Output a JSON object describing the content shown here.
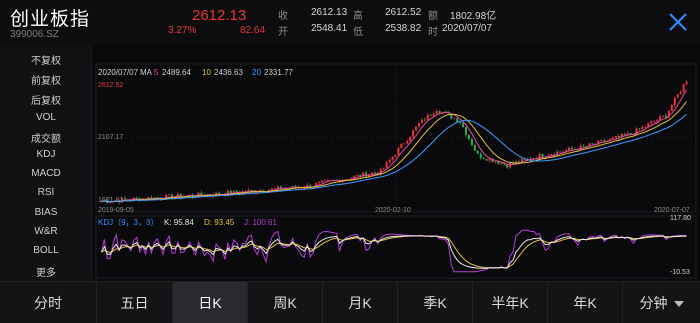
{
  "header": {
    "title": "创业板指",
    "code": "399006.SZ",
    "price": "2612.13",
    "change_pct": "3.27%",
    "change": "82.64",
    "quote": [
      {
        "label": "收",
        "value": "2612.13"
      },
      {
        "label": "高",
        "value": "2612.52"
      },
      {
        "label": "额",
        "value": "1802.98亿"
      },
      {
        "label": "开",
        "value": "2548.41"
      },
      {
        "label": "低",
        "value": "2538.82"
      },
      {
        "label": "时",
        "value": "2020/07/07"
      }
    ],
    "close_icon": "close-x-icon"
  },
  "sidebar": {
    "items": [
      {
        "label": "不复权",
        "active": true
      },
      {
        "label": "前复权",
        "active": false
      },
      {
        "label": "后复权",
        "active": false
      },
      {
        "label": "VOL",
        "active": false
      },
      {
        "label": "成交额",
        "active": false
      },
      {
        "label": "KDJ",
        "active": true
      },
      {
        "label": "MACD",
        "active": false
      },
      {
        "label": "RSI",
        "active": false
      },
      {
        "label": "BIAS",
        "active": false
      },
      {
        "label": "W&R",
        "active": false
      },
      {
        "label": "BOLL",
        "active": false
      },
      {
        "label": "更多",
        "active": false
      }
    ]
  },
  "main_chart": {
    "date": "2020/07/07",
    "ma_label": "MA",
    "ma": [
      {
        "name": "5",
        "value": "2489.64",
        "color": "#e84aa3"
      },
      {
        "name": "10",
        "value": "2436.63",
        "color": "#e0c23a"
      },
      {
        "name": "20",
        "value": "2331.77",
        "color": "#3f9bff"
      }
    ],
    "high_label": "2612.52",
    "mid_label": "2107.17",
    "low_label": "1601.81",
    "x_labels": [
      "2019-09-05",
      "2020-02-10",
      "2020-07-07"
    ]
  },
  "kdj_chart": {
    "label": "KDJ（9，3，3）",
    "k": "K: 95.84",
    "d": "D: 93.45",
    "j": "J: 100.61",
    "max_label": "117.80",
    "min_label": "-10.53",
    "colors": {
      "k": "#e8e8e8",
      "d": "#e0c23a",
      "j": "#b43fd6"
    }
  },
  "colors": {
    "up": "#e8353b",
    "down": "#27b04a",
    "accent": "#2f8fff"
  },
  "tabs": [
    {
      "label": "分时",
      "active": false
    },
    {
      "label": "五日",
      "active": false
    },
    {
      "label": "日K",
      "active": true
    },
    {
      "label": "周K",
      "active": false
    },
    {
      "label": "月K",
      "active": false
    },
    {
      "label": "季K",
      "active": false
    },
    {
      "label": "半年K",
      "active": false
    },
    {
      "label": "年K",
      "active": false
    },
    {
      "label": "分钟",
      "active": false,
      "dropdown": true
    }
  ]
}
